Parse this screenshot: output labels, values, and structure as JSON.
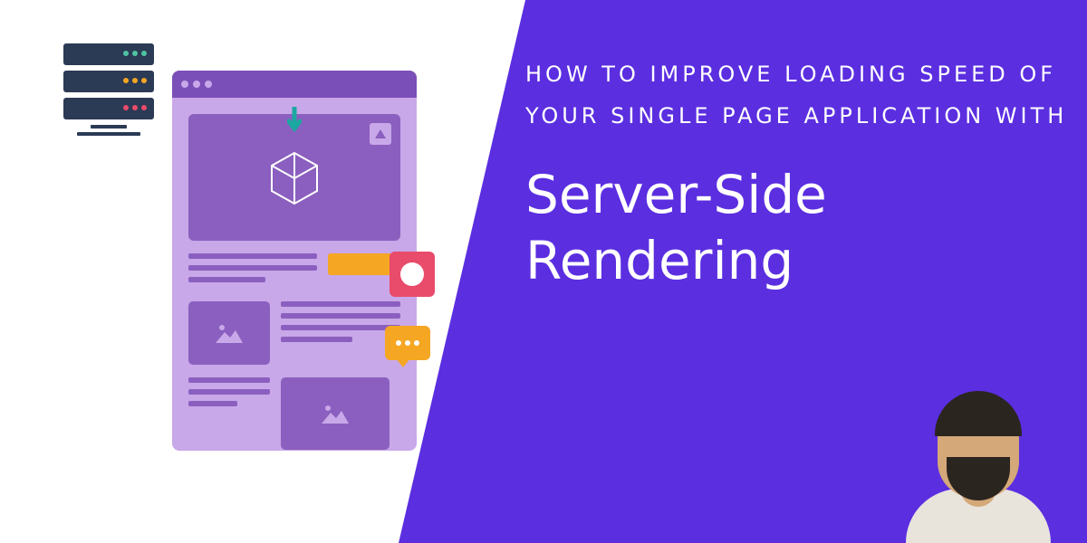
{
  "subtitle": "HOW TO IMPROVE LOADING SPEED OF YOUR SINGLE PAGE APPLICATION WITH",
  "title": "Server-Side Rendering",
  "colors": {
    "purple": "#5B2EE0",
    "lightPurple": "#C8A8E9",
    "midPurple": "#8B5FBF",
    "darkPurple": "#7B4FB8",
    "navy": "#2B3A55",
    "yellow": "#F5A623",
    "red": "#E94B6A",
    "teal": "#4FC3A1"
  }
}
